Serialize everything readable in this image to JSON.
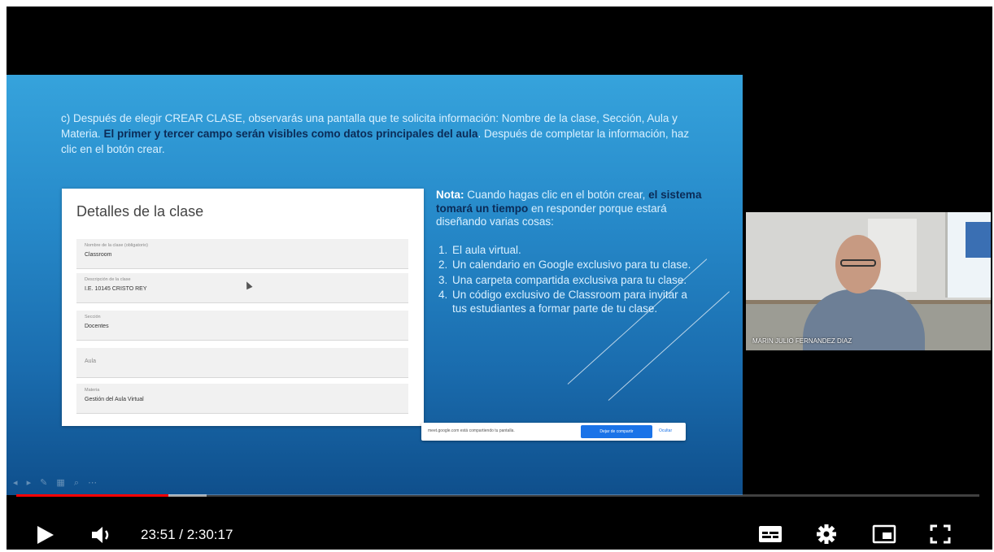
{
  "slide": {
    "intro_part1": "c) Después de elegir CREAR CLASE, observarás una pantalla que te solicita información: Nombre de la clase, Sección, Aula y Materia. ",
    "intro_highlight": "El primer y tercer campo serán visibles como datos principales del aula",
    "intro_part2": ". Después de completar la información, haz clic en el botón crear.",
    "form": {
      "title": "Detalles de la clase",
      "fields": [
        {
          "label": "Nombre de la clase (obligatorio)",
          "value": "Classroom"
        },
        {
          "label": "Descripción de la clase",
          "value": "I.E. 10145 CRISTO REY"
        },
        {
          "label": "Sección",
          "value": "Docentes"
        },
        {
          "label": "",
          "value": "",
          "placeholder": "Aula"
        },
        {
          "label": "Materia",
          "value": "Gestión del Aula Virtual"
        }
      ]
    },
    "nota": {
      "keyword": "Nota:",
      "text1": " Cuando hagas clic en el botón crear, ",
      "bold": "el sistema tomará un tiempo",
      "text2": " en responder porque estará diseñando varias cosas:",
      "items": [
        "El aula virtual.",
        "Un calendario en Google exclusivo para tu clase.",
        "Una carpeta compartida exclusiva para tu clase.",
        "Un código exclusivo de Classroom para invitar a tus estudiantes a formar parte de tu clase."
      ]
    },
    "share_bar": {
      "message": "meet.google.com está compartiendo tu pantalla.",
      "stop_label": "Dejar de compartir",
      "hide_label": "Ocultar"
    }
  },
  "webcam": {
    "name": "MARIN JULIO FERNANDEZ DIAZ"
  },
  "player": {
    "current_time": "23:51",
    "separator": " / ",
    "duration": "2:30:17",
    "played_fraction": 0.158,
    "buffered_fraction": 0.198
  },
  "icons": {
    "play": "play-icon",
    "volume": "volume-icon",
    "subtitles": "subtitles-icon",
    "settings": "gear-icon",
    "miniplayer": "miniplayer-icon",
    "fullscreen": "fullscreen-icon"
  },
  "colors": {
    "progress_played": "#ff0000",
    "slide_blue": "#2689c9"
  }
}
